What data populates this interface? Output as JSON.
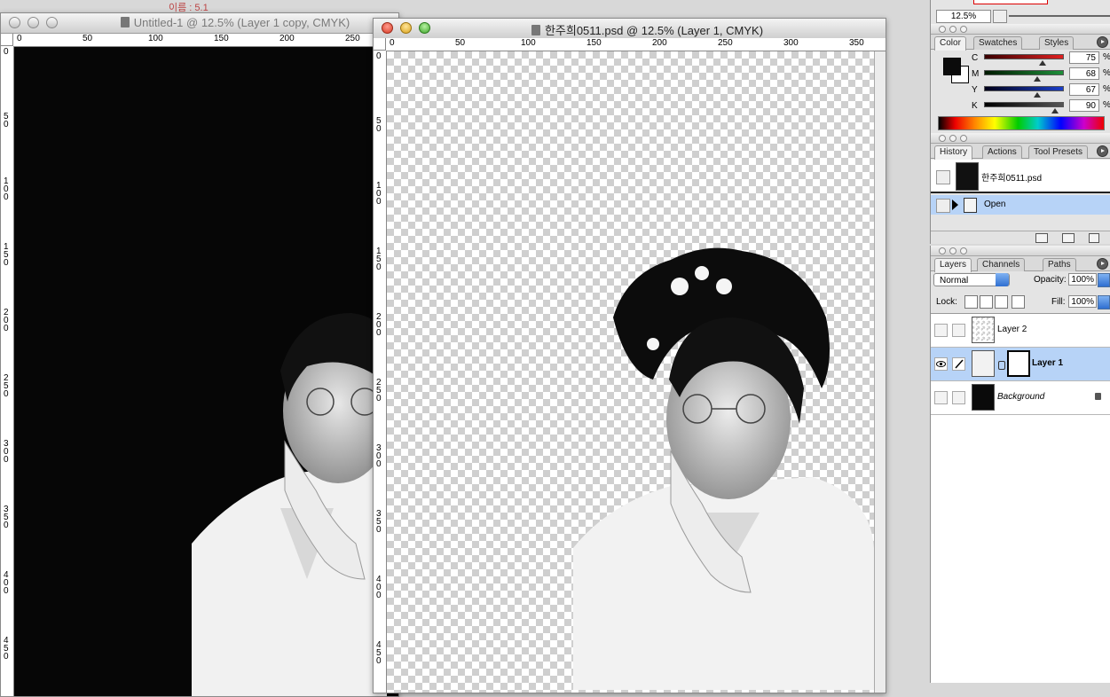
{
  "windows": {
    "back": {
      "title": "Untitled-1 @ 12.5% (Layer 1 copy, CMYK)",
      "ruler_h": [
        "0",
        "50",
        "100",
        "150",
        "200",
        "250"
      ],
      "ruler_v": [
        "0",
        "5\n0",
        "1\n0\n0",
        "1\n5\n0",
        "2\n0\n0",
        "2\n5\n0",
        "3\n0\n0",
        "3\n5\n0",
        "4\n0\n0",
        "4\n5\n0"
      ]
    },
    "front": {
      "title": "한주희0511.psd @ 12.5% (Layer 1, CMYK)",
      "ruler_h": [
        "0",
        "50",
        "100",
        "150",
        "200",
        "250",
        "300",
        "350"
      ],
      "ruler_v": [
        "0",
        "5\n0",
        "1\n0\n0",
        "1\n5\n0",
        "2\n0\n0",
        "2\n5\n0",
        "3\n0\n0",
        "3\n5\n0",
        "4\n0\n0",
        "4\n5\n0"
      ]
    }
  },
  "bg_text": "이름 : 5.1",
  "navigator": {
    "zoom": "12.5%"
  },
  "color": {
    "tabs": [
      "Color",
      "Swatches",
      "Styles"
    ],
    "active_tab": "Color",
    "channels": [
      {
        "label": "C",
        "value": "75",
        "unit": "%",
        "color": "#e02020"
      },
      {
        "label": "M",
        "value": "68",
        "unit": "%",
        "color": "#1e8f3a"
      },
      {
        "label": "Y",
        "value": "67",
        "unit": "%",
        "color": "#1a3ec8"
      },
      {
        "label": "K",
        "value": "90",
        "unit": "%",
        "color": "#000000"
      }
    ],
    "foreground": "#0b0b0b",
    "background": "#ffffff"
  },
  "history": {
    "tabs": [
      "History",
      "Actions",
      "Tool Presets"
    ],
    "active_tab": "History",
    "snapshot": "한주희0511.psd",
    "states": [
      {
        "label": "Open"
      }
    ]
  },
  "layers": {
    "tabs": [
      "Layers",
      "Channels",
      "Paths"
    ],
    "active_tab": "Layers",
    "blend_mode": "Normal",
    "opacity_label": "Opacity:",
    "opacity": "100%",
    "lock_label": "Lock:",
    "fill_label": "Fill:",
    "fill": "100%",
    "items": [
      {
        "name": "Layer 2",
        "visible": false,
        "selected": false
      },
      {
        "name": "Layer 1",
        "visible": true,
        "selected": true
      },
      {
        "name": "Background",
        "visible": false,
        "selected": false,
        "locked": true
      }
    ]
  }
}
